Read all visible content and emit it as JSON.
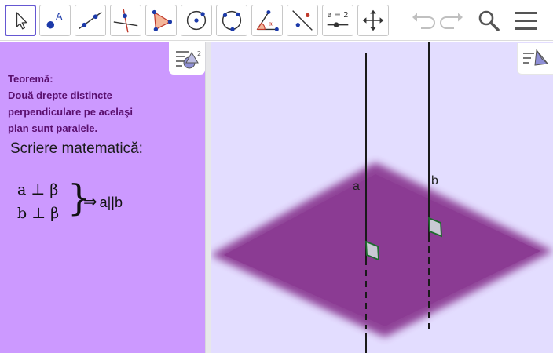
{
  "toolbar": {
    "tools": [
      {
        "name": "move-tool"
      },
      {
        "name": "point-tool"
      },
      {
        "name": "line-tool"
      },
      {
        "name": "perpendicular-line-tool"
      },
      {
        "name": "polygon-tool"
      },
      {
        "name": "circle-tool"
      },
      {
        "name": "circle-through-points-tool"
      },
      {
        "name": "angle-tool"
      },
      {
        "name": "reflect-tool"
      },
      {
        "name": "slider-tool",
        "label": "a = 2"
      },
      {
        "name": "move-graphics-view-tool"
      }
    ],
    "active_tool": "move-tool"
  },
  "algebra": {
    "theorem_title": "Teoremă:",
    "theorem_lines": [
      "Două drepte distincte",
      "perpendiculare pe acelaşi",
      "plan sunt paralele."
    ],
    "subtitle": "Scriere matematică:",
    "math_line1": "a ⊥ β",
    "math_line2": "b ⊥ β",
    "brace": "}",
    "implies": "⇒",
    "result": "a||b"
  },
  "view3d": {
    "line_a_label": "a",
    "line_b_label": "b"
  },
  "colors": {
    "algebra_bg": "#cc99ff",
    "view_bg": "#e3ddff",
    "plane": "#8b3b93",
    "active_border": "#6557d2",
    "theorem_text": "#5a0f6e"
  }
}
